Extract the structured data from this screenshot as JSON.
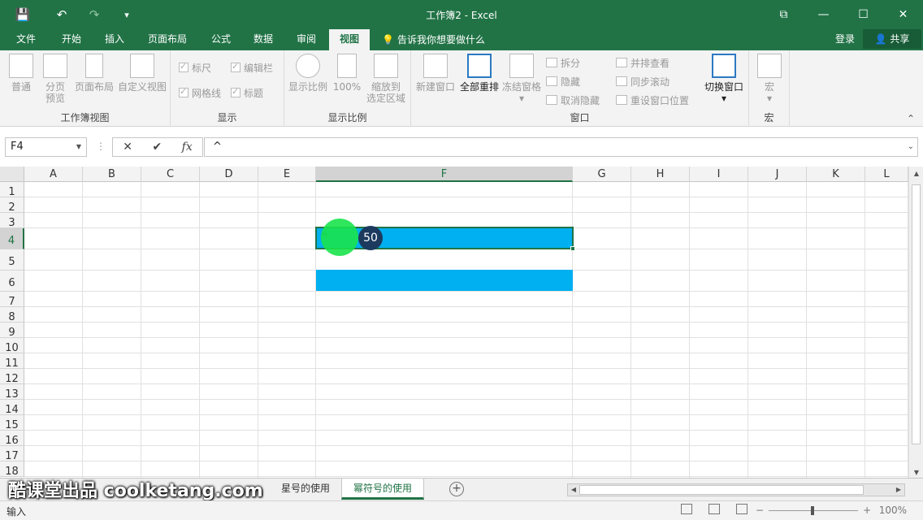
{
  "titlebar": {
    "title": "工作簿2 - Excel",
    "save_icon": "💾",
    "undo_icon": "↶",
    "redo_icon": "↷",
    "customize_icon": "▾",
    "ribbon_display_icon": "⧉",
    "minimize_icon": "—",
    "maximize_icon": "☐",
    "close_icon": "✕"
  },
  "tabs": [
    "文件",
    "开始",
    "插入",
    "页面布局",
    "公式",
    "数据",
    "审阅",
    "视图"
  ],
  "active_tab": "视图",
  "tellme": "告诉我你想要做什么",
  "login": "登录",
  "share": "共享",
  "ribbon": {
    "workbook_views": {
      "label": "工作簿视图",
      "normal": "普通",
      "page_break_1": "分页",
      "page_break_2": "预览",
      "page_layout": "页面布局",
      "custom_views": "自定义视图"
    },
    "show": {
      "label": "显示",
      "ruler": "标尺",
      "formula_bar": "编辑栏",
      "gridlines": "网格线",
      "headings": "标题"
    },
    "zoom": {
      "label": "显示比例",
      "zoom": "显示比例",
      "hundred": "100%",
      "zoom_sel_1": "缩放到",
      "zoom_sel_2": "选定区域"
    },
    "window": {
      "label": "窗口",
      "new_window": "新建窗口",
      "arrange_all": "全部重排",
      "freeze_panes": "冻结窗格",
      "split": "拆分",
      "hide": "隐藏",
      "unhide": "取消隐藏",
      "side_by_side": "并排查看",
      "sync_scroll": "同步滚动",
      "reset_position": "重设窗口位置",
      "switch_windows": "切换窗口"
    },
    "macros": {
      "label": "宏",
      "macros": "宏"
    }
  },
  "formula_bar": {
    "name_box": "F4",
    "cancel_icon": "✕",
    "enter_icon": "✔",
    "fx": "fx",
    "content": "^"
  },
  "columns": [
    "A",
    "B",
    "C",
    "D",
    "E",
    "F",
    "G",
    "H",
    "I",
    "J",
    "K",
    "L"
  ],
  "rows": [
    "1",
    "2",
    "3",
    "4",
    "5",
    "6",
    "7",
    "8",
    "9",
    "10",
    "11",
    "12",
    "13",
    "14",
    "15",
    "16",
    "17",
    "18"
  ],
  "selected_cell": "F4",
  "cell_F4_value": "^",
  "fill_color": "#00b0f0",
  "accent_color": "#217346",
  "badge_value": "50",
  "sheets": [
    "星号的使用",
    "幂符号的使用"
  ],
  "active_sheet": "幂符号的使用",
  "watermark": "酷课堂出品 coolketang.com",
  "status": {
    "mode": "输入",
    "zoom": "100%",
    "zoom_minus": "−",
    "zoom_plus": "+"
  }
}
